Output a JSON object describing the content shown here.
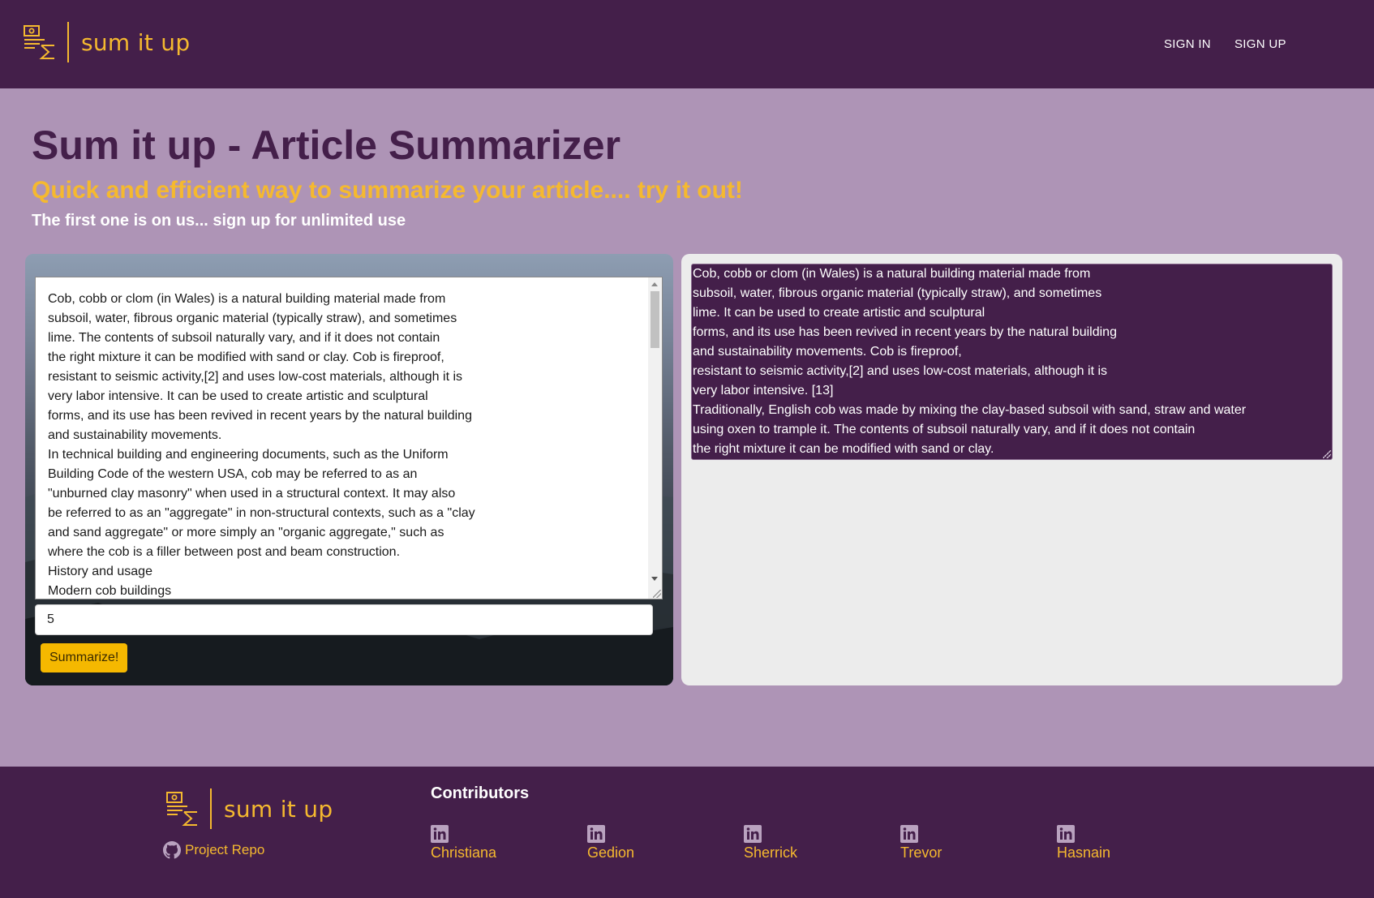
{
  "header": {
    "brand": "sum it up",
    "nav": [
      "SIGN IN",
      "SIGN UP"
    ]
  },
  "hero": {
    "title": "Sum it up - Article Summarizer",
    "subtitle": "Quick and efficient way to summarize your article.... try it out!",
    "note": "The first one is on us... sign up for unlimited use"
  },
  "form": {
    "article_text": "Cob, cobb or clom (in Wales) is a natural building material made from\nsubsoil, water, fibrous organic material (typically straw), and sometimes\nlime. The contents of subsoil naturally vary, and if it does not contain\nthe right mixture it can be modified with sand or clay. Cob is fireproof,\nresistant to seismic activity,[2] and uses low-cost materials, although it is\nvery labor intensive. It can be used to create artistic and sculptural\nforms, and its use has been revived in recent years by the natural building\nand sustainability movements.\nIn technical building and engineering documents, such as the Uniform\nBuilding Code of the western USA, cob may be referred to as an\n\"unburned clay masonry\" when used in a structural context. It may also\nbe referred to as an \"aggregate\" in non-structural contexts, such as a \"clay\nand sand aggregate\" or more simply an \"organic aggregate,\" such as\nwhere the cob is a filler between post and beam construction.\nHistory and usage\nModern cob buildings",
    "sentence_count": "5",
    "summarize_label": "Summarize!"
  },
  "result": {
    "summary_text": "Cob, cobb or clom (in Wales) is a natural building material made from\nsubsoil, water, fibrous organic material (typically straw), and sometimes\nlime. It can be used to create artistic and sculptural\nforms, and its use has been revived in recent years by the natural building\nand sustainability movements. Cob is fireproof,\nresistant to seismic activity,[2] and uses low-cost materials, although it is\nvery labor intensive. [13]\nTraditionally, English cob was made by mixing the clay-based subsoil with sand, straw and water\nusing oxen to trample it. The contents of subsoil naturally vary, and if it does not contain\nthe right mixture it can be modified with sand or clay."
  },
  "footer": {
    "brand": "sum it up",
    "repo_label": "Project Repo",
    "contributors_heading": "Contributors",
    "contributors": [
      "Christiana",
      "Gedion",
      "Sherrick",
      "Trevor",
      "Hasnain"
    ]
  },
  "icons": {
    "logo": "summarize-logo-icon",
    "repo": "github-icon",
    "contributor": "linkedin-icon"
  },
  "colors": {
    "bar_background": "#441f4a",
    "page_background": "#ae94b6",
    "accent": "#f5b92f",
    "button": "#f5b800",
    "result_panel": "#ececec"
  }
}
